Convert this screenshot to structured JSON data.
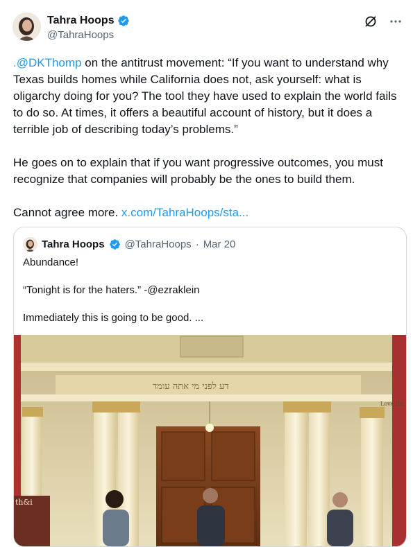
{
  "author": {
    "name": "Tahra Hoops",
    "handle": "@TahraHoops",
    "verified": true,
    "avatar": "avatar-photo"
  },
  "icons": {
    "verified": "verified-badge-icon",
    "grok": "grok-icon",
    "more": "more-icon"
  },
  "tweet": {
    "mention": ".@DKThomp",
    "paragraph1_rest": " on the antitrust movement: “If you want to understand why Texas builds homes while California does not, ask yourself: what is oligarchy doing for you? The tool they have used to explain the world fails to do so. At times, it offers a beautiful account of history, but it does a terrible job of describing today’s problems.”",
    "paragraph2": "He goes on to explain that if you want progressive outcomes, you must recognize that companies will probably be the ones to build them.",
    "paragraph3_text": "Cannot agree more. ",
    "paragraph3_link": "x.com/TahraHoops/sta..."
  },
  "quote": {
    "name": "Tahra Hoops",
    "handle": "@TahraHoops",
    "separator": "·",
    "date": "Mar 20",
    "lines": [
      "Abundance!",
      "“Tonight is for the haters.” -@ezraklein",
      "Immediately this is going to be good. ..."
    ],
    "image": {
      "description_icon": "stage-photo",
      "sign_text": "th&i",
      "banner_text": "דע לפני מי אתה עומד",
      "side_text": "Love the s"
    }
  },
  "colors": {
    "link": "#1d9bf0",
    "verified": "#1d9bf0",
    "secondary_text": "#536471",
    "border": "#cfd9de"
  }
}
